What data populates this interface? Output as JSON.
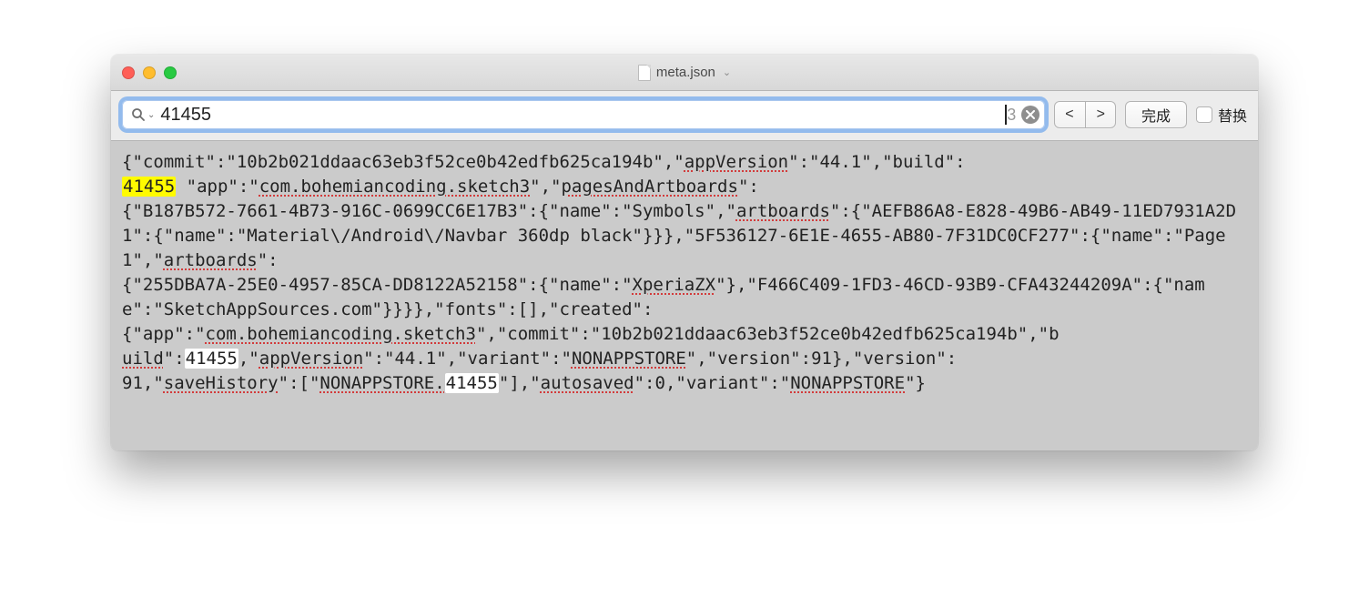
{
  "titlebar": {
    "filename": "meta.json"
  },
  "findbar": {
    "query": "41455",
    "result_count": "3",
    "prev": "<",
    "next": ">",
    "done": "完成",
    "replace_label": "替换"
  },
  "content": {
    "commit": "10b2b021ddaac63eb3f52ce0b42edfb625ca194b",
    "appVersion": "44.1",
    "build": "41455",
    "app": "com.bohemiancoding.sketch3",
    "pagesAndArtboards_label": "pagesAndArtboards",
    "page1_guid": "B187B572-7661-4B73-916C-0699CC6E17B3",
    "page1_name": "Symbols",
    "artboards_label": "artboards",
    "ab1_guid": "AEFB86A8-E828-49B6-AB49-11ED7931A2D1",
    "ab1_name": "Material\\/Android\\/Navbar 360dp black",
    "page2_guid": "5F536127-6E1E-4655-AB80-7F31DC0CF277",
    "page2_name": "Page 1",
    "ab2_guid": "255DBA7A-25E0-4957-85CA-DD8122A52158",
    "ab2_name": "XperiaZX",
    "ab3_guid": "F466C409-1FD3-46CD-93B9-CFA43244209A",
    "ab3_name": "SketchAppSources.com",
    "fonts_label": "fonts",
    "created_label": "created",
    "created_app": "com.bohemiancoding.sketch3",
    "created_commit": "10b2b021ddaac63eb3f52ce0b42edfb625ca194b",
    "created_build": "41455",
    "created_appVersion": "44.1",
    "variant": "NONAPPSTORE",
    "created_version": "91",
    "version": "91",
    "saveHistory_label": "saveHistory",
    "saveHistory_prefix": "NONAPPSTORE.",
    "saveHistory_suffix": "41455",
    "autosaved_label": "autosaved",
    "autosaved": "0",
    "variant2": "NONAPPSTORE"
  }
}
